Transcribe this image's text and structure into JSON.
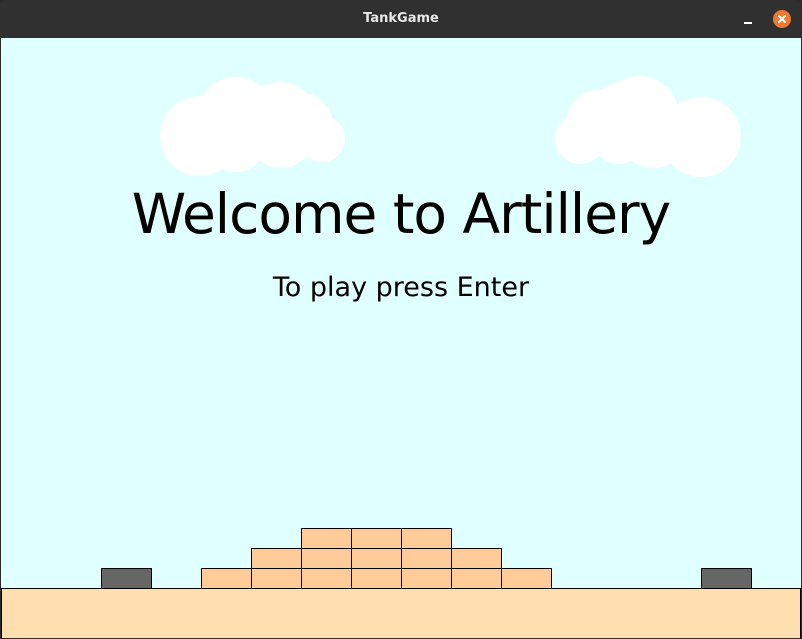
{
  "window": {
    "title": "TankGame",
    "controls": {
      "minimize_icon": "minimize-icon",
      "close_icon": "close-icon"
    },
    "colors": {
      "titlebar": "#303030",
      "close_button": "#f07830"
    }
  },
  "game": {
    "heading": "Welcome to Artillery",
    "subheading": "To play press Enter",
    "colors": {
      "sky": "#e0ffff",
      "ground": "#ffdfaf",
      "terrain_block": "#ffcc99",
      "tank": "#666666",
      "cloud": "#ffffff"
    }
  }
}
